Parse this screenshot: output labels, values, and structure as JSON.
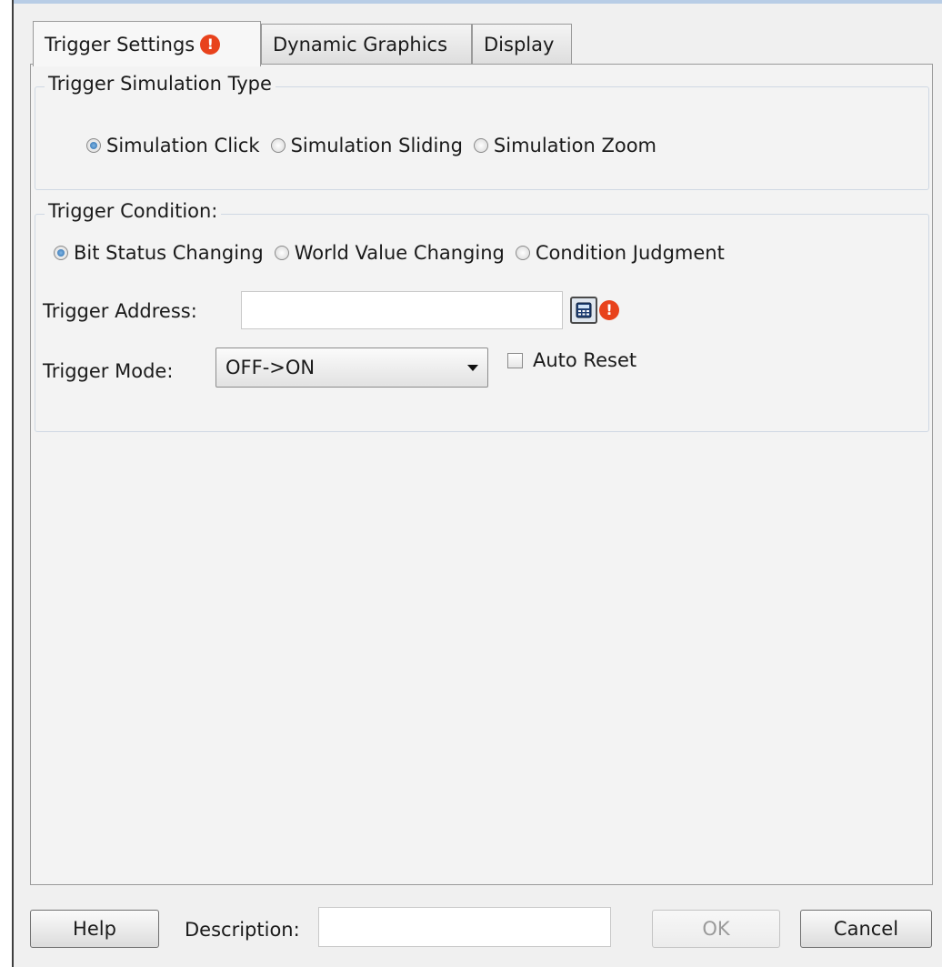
{
  "tabs": [
    {
      "label": "Trigger Settings",
      "active": true,
      "has_warning": true
    },
    {
      "label": "Dynamic Graphics",
      "active": false
    },
    {
      "label": "Display",
      "active": false
    }
  ],
  "simulation_group": {
    "title": "Trigger Simulation Type",
    "options": [
      {
        "label": "Simulation Click",
        "checked": true
      },
      {
        "label": "Simulation Sliding",
        "checked": false
      },
      {
        "label": "Simulation Zoom",
        "checked": false
      }
    ]
  },
  "condition_group": {
    "title": "Trigger Condition:",
    "options": [
      {
        "label": "Bit Status Changing",
        "checked": true
      },
      {
        "label": "World Value Changing",
        "checked": false
      },
      {
        "label": "Condition Judgment",
        "checked": false
      }
    ],
    "address_label": "Trigger Address:",
    "address_value": "",
    "mode_label": "Trigger Mode:",
    "mode_value": "OFF->ON",
    "auto_reset_label": "Auto Reset",
    "auto_reset_checked": false
  },
  "footer": {
    "help_label": "Help",
    "description_label": "Description:",
    "description_value": "",
    "ok_label": "OK",
    "ok_enabled": false,
    "cancel_label": "Cancel"
  },
  "icons": {
    "warning": "warning-icon",
    "calculator": "calculator-icon",
    "dropdown": "chevron-down-icon"
  },
  "colors": {
    "warning": "#e8421c",
    "radio_selected": "#2a6cad",
    "dialog_background": "#f0f0f0"
  }
}
